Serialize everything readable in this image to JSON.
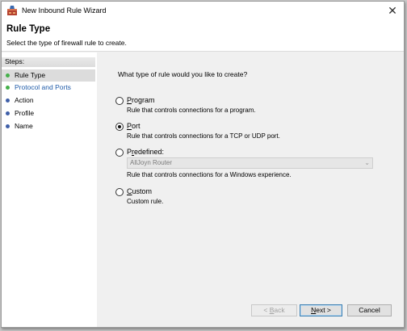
{
  "window": {
    "title": "New Inbound Rule Wizard",
    "close_glyph": "✕",
    "icon": "firewall-shield-icon"
  },
  "header": {
    "title": "Rule Type",
    "subtitle": "Select the type of firewall rule to create."
  },
  "steps": {
    "heading": "Steps:",
    "items": [
      {
        "label": "Rule Type",
        "state": "active",
        "dot_color": "#44b04a"
      },
      {
        "label": "Protocol and Ports",
        "state": "link",
        "dot_color": "#44b04a"
      },
      {
        "label": "Action",
        "state": "normal",
        "dot_color": "#3f5fa8"
      },
      {
        "label": "Profile",
        "state": "normal",
        "dot_color": "#3f5fa8"
      },
      {
        "label": "Name",
        "state": "normal",
        "dot_color": "#3f5fa8"
      }
    ]
  },
  "main": {
    "question": "What type of rule would you like to create?",
    "options": [
      {
        "accel": "P",
        "rest": "rogram",
        "description": "Rule that controls connections for a program.",
        "checked": false
      },
      {
        "accel": "P",
        "rest": "ort",
        "description": "Rule that controls connections for a TCP or UDP port.",
        "checked": true
      },
      {
        "pre": "P",
        "accel": "r",
        "rest": "edefined:",
        "description": "Rule that controls connections for a Windows experience.",
        "checked": false
      },
      {
        "accel": "C",
        "rest": "ustom",
        "description": "Custom rule.",
        "checked": false
      }
    ],
    "predefined_select": {
      "value": "AllJoyn Router",
      "disabled": true
    }
  },
  "buttons": {
    "back": {
      "pre": "< ",
      "accel": "B",
      "rest": "ack",
      "disabled": true
    },
    "next": {
      "accel": "N",
      "rest": "ext >",
      "default": true
    },
    "cancel": {
      "label": "Cancel"
    }
  }
}
